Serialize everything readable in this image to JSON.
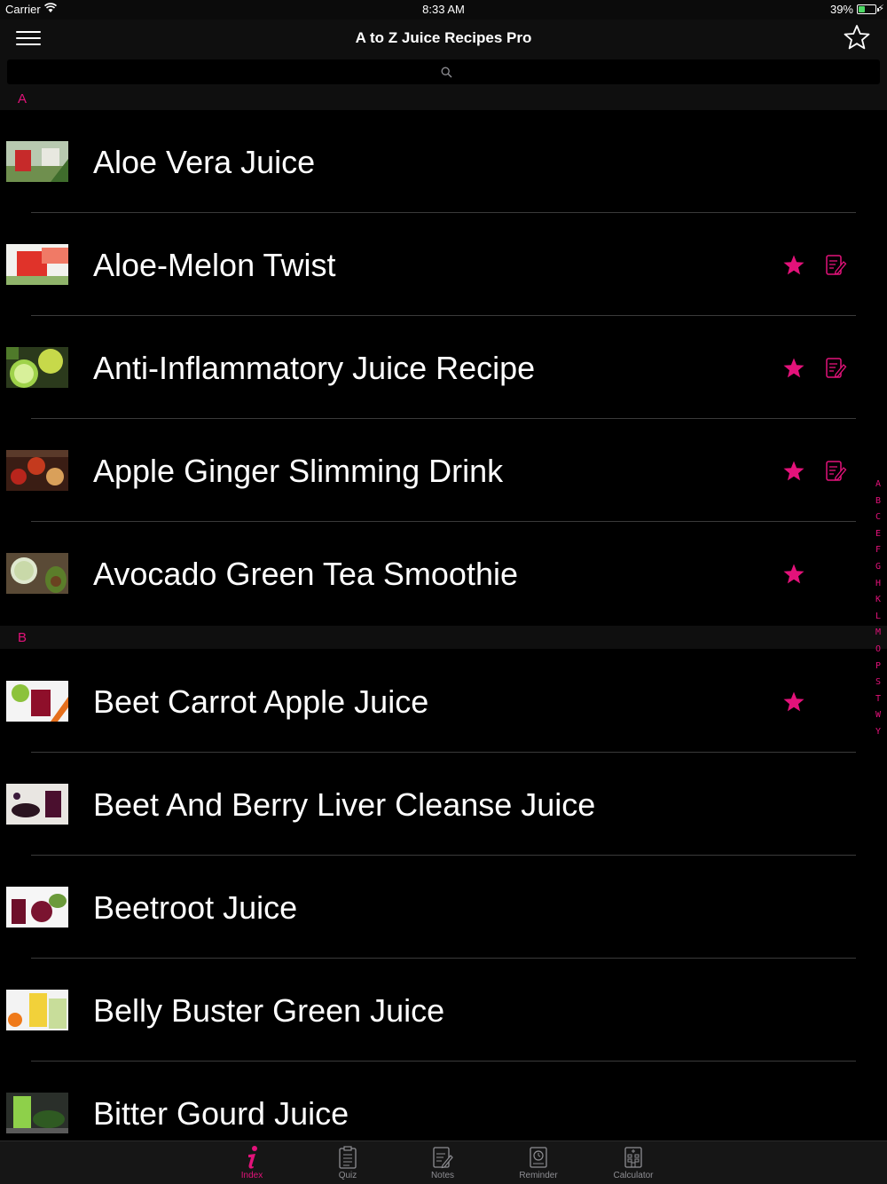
{
  "status_bar": {
    "carrier": "Carrier",
    "time": "8:33 AM",
    "battery": "39%",
    "battery_level": 0.39
  },
  "nav": {
    "title": "A to Z Juice Recipes Pro",
    "menu_icon": "hamburger-menu-icon",
    "favorites_icon": "star-outline-icon"
  },
  "search": {
    "placeholder": "",
    "value": ""
  },
  "sections": [
    {
      "letter": "A",
      "items": [
        {
          "name": "Aloe Vera Juice",
          "favorite": false,
          "has_note": false
        },
        {
          "name": "Aloe-Melon Twist",
          "favorite": true,
          "has_note": true
        },
        {
          "name": "Anti-Inflammatory Juice Recipe",
          "favorite": true,
          "has_note": true
        },
        {
          "name": "Apple Ginger Slimming Drink",
          "favorite": true,
          "has_note": true
        },
        {
          "name": "Avocado Green Tea Smoothie",
          "favorite": true,
          "has_note": false
        }
      ]
    },
    {
      "letter": "B",
      "items": [
        {
          "name": "Beet Carrot Apple Juice",
          "favorite": true,
          "has_note": false
        },
        {
          "name": "Beet And Berry Liver Cleanse Juice",
          "favorite": false,
          "has_note": false
        },
        {
          "name": "Beetroot Juice",
          "favorite": false,
          "has_note": false
        },
        {
          "name": "Belly Buster Green Juice",
          "favorite": false,
          "has_note": false
        },
        {
          "name": "Bitter Gourd Juice",
          "favorite": false,
          "has_note": false
        }
      ]
    }
  ],
  "index_letters": [
    "A",
    "B",
    "C",
    "E",
    "F",
    "G",
    "H",
    "K",
    "L",
    "M",
    "O",
    "P",
    "S",
    "T",
    "W",
    "Y"
  ],
  "tabs": [
    {
      "label": "Index",
      "icon": "info-icon",
      "active": true
    },
    {
      "label": "Quiz",
      "icon": "quiz-clipboard-icon",
      "active": false
    },
    {
      "label": "Notes",
      "icon": "notes-icon",
      "active": false
    },
    {
      "label": "Reminder",
      "icon": "reminder-clock-icon",
      "active": false
    },
    {
      "label": "Calculator",
      "icon": "calculator-icon",
      "active": false
    }
  ],
  "colors": {
    "accent": "#e3127a",
    "background": "#000000",
    "bar": "#0f0f0f",
    "separator": "#3a3a3a"
  }
}
